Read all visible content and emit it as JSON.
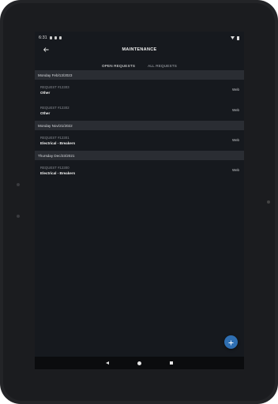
{
  "status": {
    "time": "6:31"
  },
  "appbar": {
    "title": "MAINTENANCE",
    "back_icon": "arrow-left-icon"
  },
  "tabs": [
    {
      "label": "OPEN REQUESTS",
      "active": true
    },
    {
      "label": "ALL REQUESTS",
      "active": false
    }
  ],
  "groups": [
    {
      "date": "Monday Feb/13/2023",
      "items": [
        {
          "id": "REQUEST #12303",
          "category": "Other",
          "source": "Web"
        },
        {
          "id": "REQUEST #12302",
          "category": "Other",
          "source": "Web"
        }
      ]
    },
    {
      "date": "Monday Nov/21/2022",
      "items": [
        {
          "id": "REQUEST #12301",
          "category": "Electrical - Breakers",
          "source": "Web"
        }
      ]
    },
    {
      "date": "Thursday Dec/23/2021",
      "items": [
        {
          "id": "REQUEST #12300",
          "category": "Electrical - Breakers",
          "source": "Web"
        }
      ]
    }
  ],
  "fab": {
    "icon": "plus-icon",
    "color": "#2f6fb2"
  },
  "colors": {
    "background": "#16191e",
    "header_bg": "#2a2d33",
    "accent": "#2f6fb2"
  }
}
